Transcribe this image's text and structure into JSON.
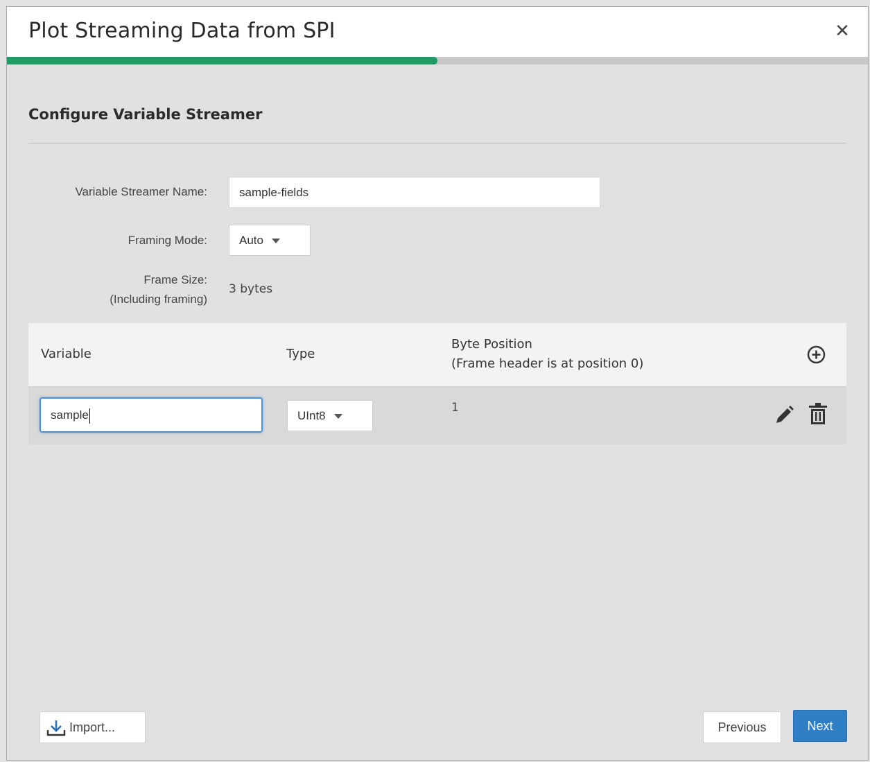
{
  "dialog": {
    "title": "Plot Streaming Data from SPI",
    "close_symbol": "✕",
    "progress": 0.5
  },
  "section": {
    "title": "Configure Variable Streamer"
  },
  "form": {
    "name_label": "Variable Streamer Name:",
    "name_value": "sample-fields",
    "framing_label": "Framing Mode:",
    "framing_value": "Auto",
    "frame_size_label": "Frame Size:",
    "frame_size_sublabel": "(Including framing)",
    "frame_size_value": "3 bytes"
  },
  "table": {
    "headers": {
      "variable": "Variable",
      "type": "Type",
      "byte_position": "Byte Position",
      "byte_position_note": "(Frame header is at position 0)"
    },
    "add_icon": "add-circle-icon",
    "rows": [
      {
        "variable": "sample",
        "type": "UInt8",
        "byte_position": "1",
        "edit_icon": "pencil-icon",
        "delete_icon": "trash-icon"
      }
    ]
  },
  "footer": {
    "import_label": "Import...",
    "import_icon": "download-icon",
    "previous_label": "Previous",
    "next_label": "Next"
  },
  "colors": {
    "progress": "#1e9c63",
    "primary": "#2f7fc4",
    "focus": "#4a90d9"
  }
}
